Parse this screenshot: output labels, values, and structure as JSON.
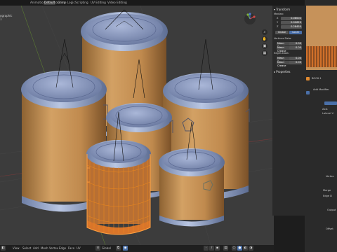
{
  "workspace_tabs": [
    {
      "label": "Animation",
      "active": false
    },
    {
      "label": "Compositing",
      "active": false
    },
    {
      "label": "Default",
      "active": true
    },
    {
      "label": "Game Logic",
      "active": false
    },
    {
      "label": "Scripting",
      "active": false
    },
    {
      "label": "UV Editing",
      "active": false
    },
    {
      "label": "Video Editing",
      "active": false
    }
  ],
  "top_right": {
    "scene_label": "Scene"
  },
  "viewport": {
    "info_lines": [
      "ographic",
      "1"
    ],
    "colors": {
      "background": "#3c3c3c",
      "can_body": "#c99758",
      "can_lid": "#8fa2cc",
      "selection": "#f08a1c"
    }
  },
  "n_panel": {
    "transform_header": "Transform",
    "median_label": "Median:",
    "coords": [
      {
        "axis": "X",
        "value": "0.08002"
      },
      {
        "axis": "Y",
        "value": "0.00620"
      },
      {
        "axis": "Z",
        "value": "0.28450"
      }
    ],
    "mode_global": "Global",
    "mode_local": "Local",
    "vertices_data_label": "Vertices Data:",
    "vertex_rows": [
      {
        "label": "Mean Bevel",
        "value": "0.00"
      },
      {
        "label": "Mean Crease",
        "value": "0.00"
      }
    ],
    "edges_data_label": "Edges Data:",
    "edge_rows": [
      {
        "label": "Mean Bevel",
        "value": "0.00"
      },
      {
        "label": "Mean Crease",
        "value": "0.00"
      }
    ],
    "properties_header": "Properties"
  },
  "properties_editor": {
    "object_name": "BOOX.1",
    "add_modifier_label": "Add Modifier",
    "partial_labels": [
      "Axis",
      "Lateral V",
      "Vertex",
      "Merge",
      "Edge D",
      "Output",
      "Offset"
    ]
  },
  "status_bar": {
    "menus": [
      "View",
      "Select",
      "Add",
      "Mesh",
      "Vertex",
      "Edge",
      "Face",
      "UV"
    ],
    "pivot_label": "Global"
  }
}
